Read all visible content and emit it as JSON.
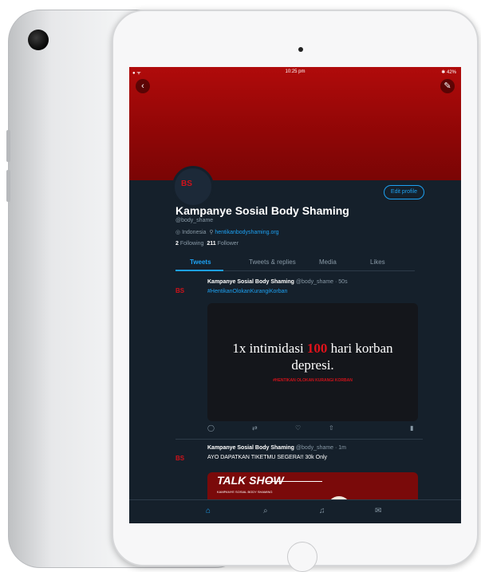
{
  "status_bar": {
    "time": "10:25 pm",
    "left": "● ᯤ",
    "right": "✱ 42%"
  },
  "nav": {
    "back_icon": "back-arrow-icon",
    "tools_icon": "tools-icon"
  },
  "profile": {
    "avatar_label": "BS",
    "edit_profile": "Edit profile",
    "display_name": "Kampanye Sosial Body Shaming",
    "handle": "@body_shame",
    "location": "Indonesia",
    "website": "hentikanbodyshaming.org",
    "following_count": "2",
    "following_label": "Following",
    "followers_count": "211",
    "followers_label": "Follower"
  },
  "tabs": [
    "Tweets",
    "Tweets & replies",
    "Media",
    "Likes"
  ],
  "tweets": [
    {
      "author": "Kampanye Sosial Body Shaming",
      "handle_time": "@body_shame · 50s",
      "text": "#HentikanOlokanKurangiKorban",
      "media": {
        "line1_prefix": "1x intimidasi ",
        "line1_number": "100",
        "line1_suffix": " hari korban",
        "line2": "depresi.",
        "sub": "#HENTIKAN OLOKAN KURANGI KORBAN"
      }
    },
    {
      "author": "Kampanye Sosial Body Shaming",
      "handle_time": "@body_shame · 1m",
      "text": "AYO DAPATKAN TIKETMU SEGERA!! 30k Only",
      "media": {
        "title": "TALK SHOW",
        "sub": "KAMPANYE SOSIAL BODY SHAMING"
      }
    }
  ],
  "colors": {
    "banner": "#b00b0b",
    "background": "#15202b",
    "accent": "#1da1f2"
  }
}
